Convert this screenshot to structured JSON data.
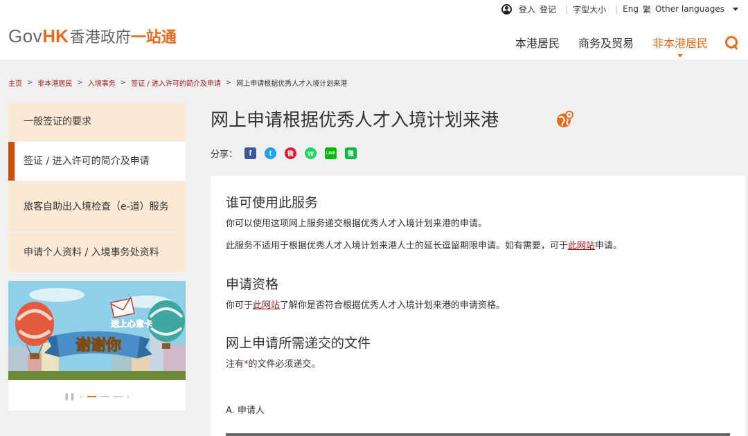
{
  "header": {
    "util": {
      "login": "登入",
      "register": "登记",
      "font_size": "字型大小",
      "lang_eng": "Eng",
      "lang_trad": "繁",
      "other_languages": "Other languages"
    },
    "logo": {
      "gov": "Gov",
      "hk": "HK",
      "cn": "香港政府",
      "cn2": "一站通"
    },
    "nav": {
      "residents": "本港居民",
      "business": "商务及贸易",
      "non_residents": "非本港居民"
    }
  },
  "breadcrumb": {
    "home": "主页",
    "non_residents": "非本港居民",
    "immigration": "入境事务",
    "visa": "签证 / 进入许可的简介及申请",
    "current": "网上申请根据优秀人才入境计划来港",
    "sep": ">"
  },
  "sidebar": {
    "items": [
      {
        "label": "一般签证的要求"
      },
      {
        "label": "签证 / 进入许可的简介及申请"
      },
      {
        "label": "旅客自助出入境检查（e-道）服务"
      },
      {
        "label": "申请个人资料 / 入境事务处资料"
      }
    ]
  },
  "banner": {
    "text_card": "送上心意卡",
    "text_thanks": "谢谢你"
  },
  "main": {
    "title": "网上申请根据优秀人才入境计划来港",
    "share_label": "分享：",
    "share_icons": {
      "facebook": "f",
      "twitter": "t",
      "weibo": "微",
      "whatsapp": "w",
      "line": "LINE",
      "wechat": "微"
    },
    "colors": {
      "accent": "#e56b1f",
      "link": "#a01818",
      "sidebar_bg": "#fde8d4",
      "active_bar": "#c9500f"
    },
    "sections": {
      "who_title": "谁可使用此服务",
      "who_p1": "你可以使用这项网上服务递交根据优秀人才入境计划来港的申请。",
      "who_p2_a": "此服务不适用于根据优秀人才入境计划来港人士的延长逗留期限申请。如有需要，可于",
      "who_p2_link": "此网站",
      "who_p2_b": "申请。",
      "elig_title": "申请资格",
      "elig_a": "你可于",
      "elig_link": "此网站",
      "elig_b": "了解你是否符合根据优秀人才入境计划来港的申请资格。",
      "docs_title": "网上申请所需递交的文件",
      "docs_a": "注有",
      "docs_star": "*",
      "docs_b": "的文件必须递交。",
      "applicant": "A. 申请人"
    }
  }
}
